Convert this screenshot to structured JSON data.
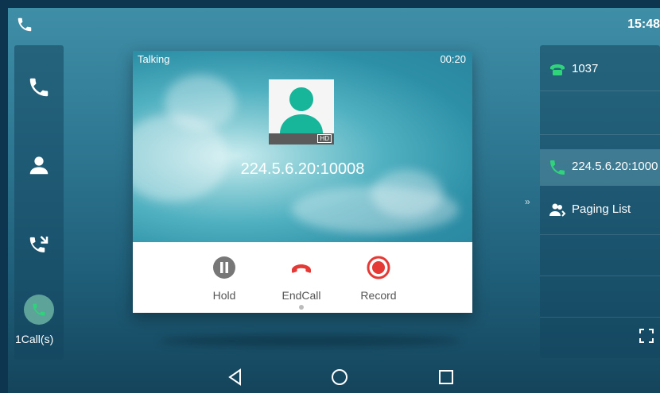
{
  "status_bar": {
    "time": "15:48"
  },
  "sidebar": {
    "calls_count_label": "1Call(s)"
  },
  "call": {
    "state": "Talking",
    "duration": "00:20",
    "remote_number": "224.5.6.20:10008",
    "hd_badge": "HD",
    "actions": [
      {
        "label": "Hold",
        "icon": "pause-icon",
        "color": "#777777"
      },
      {
        "label": "EndCall",
        "icon": "end-call-icon",
        "color": "#e53935"
      },
      {
        "label": "Record",
        "icon": "record-icon",
        "color": "#e53935"
      }
    ]
  },
  "right_panel": {
    "items": [
      {
        "label": "1037",
        "icon": "line-key-phone-icon"
      },
      {
        "label": "224.5.6.20:1000",
        "icon": "phone-icon"
      },
      {
        "label": "Paging List",
        "icon": "paging-list-icon"
      }
    ]
  },
  "colors": {
    "accent_green": "#3cc48a",
    "end_call_red": "#e53935"
  }
}
